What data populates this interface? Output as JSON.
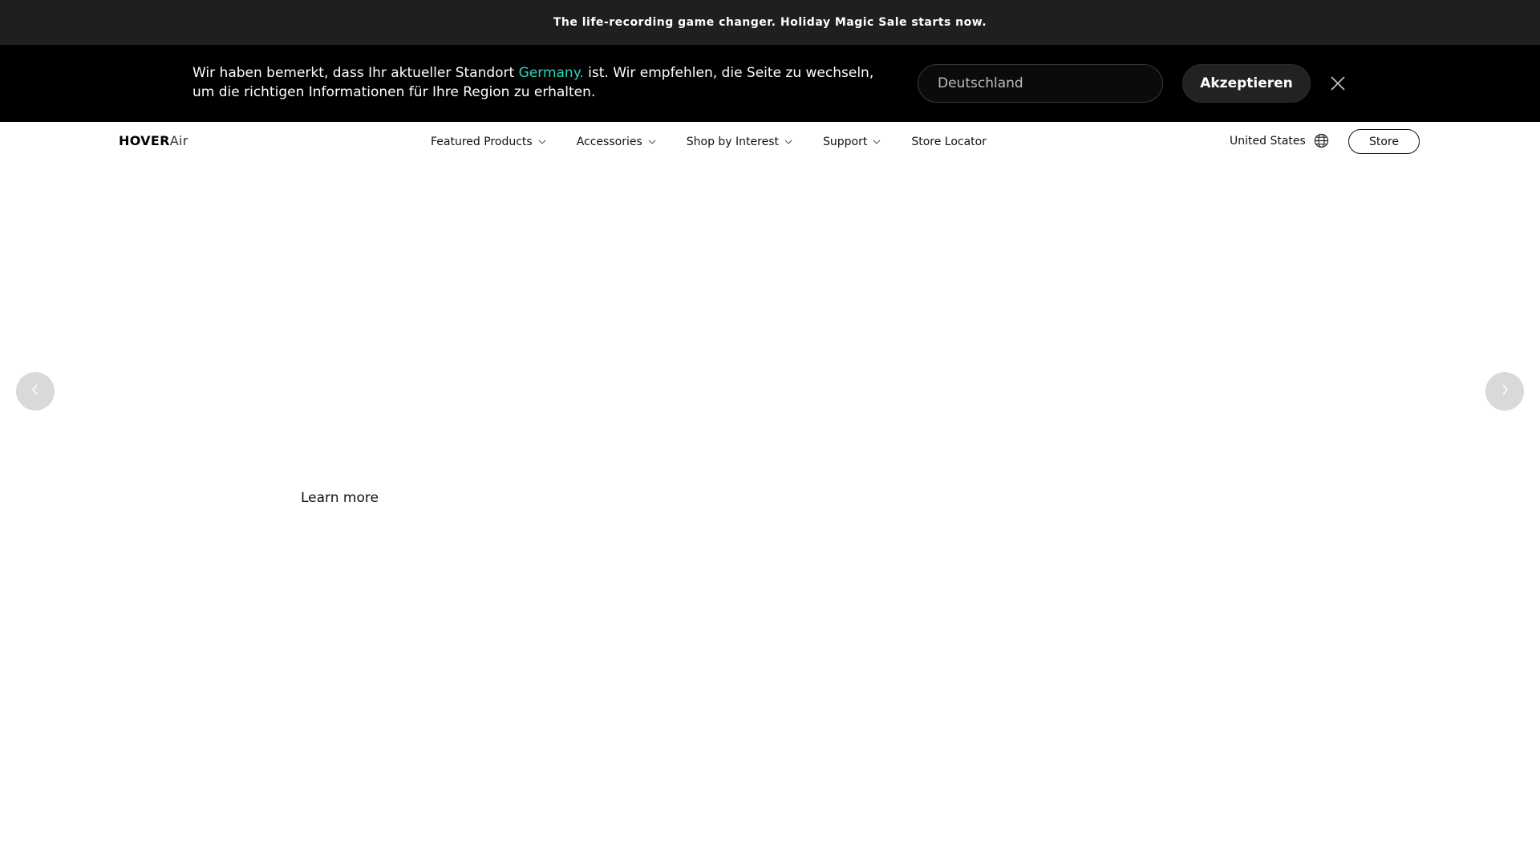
{
  "promo": {
    "text": "The life-recording game changer. Holiday Magic Sale starts now."
  },
  "region_banner": {
    "message_part1": "Wir haben bemerkt, dass Ihr aktueller Standort ",
    "location": "Germany.",
    "message_part2": " ist. Wir empfehlen, die Seite zu wechseln, um die richtigen Informationen für Ihre Region zu erhalten.",
    "highlight_color": "#2fd4b9",
    "select_value": "Deutschland",
    "accept_label": "Akzeptieren",
    "close_icon": "close-icon"
  },
  "header": {
    "logo_bold": "HOVER",
    "logo_light": "Air",
    "nav": [
      {
        "label": "Featured Products",
        "has_dropdown": true
      },
      {
        "label": "Accessories",
        "has_dropdown": true
      },
      {
        "label": "Shop by Interest",
        "has_dropdown": true
      },
      {
        "label": "Support",
        "has_dropdown": true
      },
      {
        "label": "Store Locator",
        "has_dropdown": false
      }
    ],
    "region_label": "United States",
    "region_icon": "globe-icon",
    "store_label": "Store"
  },
  "hero": {
    "learn_more": "Learn more",
    "prev_icon": "chevron-left-icon",
    "next_icon": "chevron-right-icon"
  }
}
